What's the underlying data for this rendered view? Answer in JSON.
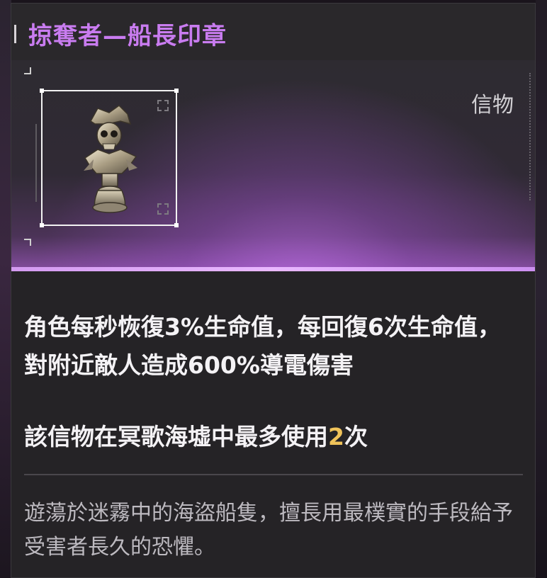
{
  "item": {
    "name": "掠奪者—船長印章",
    "category": "信物",
    "image_icon": "skull-pirate-captain-chess-piece-icon",
    "effect_text": "角色每秒恢復3%生命值，每回復6次生命值，對附近敵人造成600%導電傷害",
    "usage_prefix": "該信物在冥歌海墟中最多使用",
    "usage_count": "2",
    "usage_suffix": "次",
    "flavor_text": "遊蕩於迷霧中的海盜船隻，擅長用最樸實的手段給予受害者長久的恐懼。"
  },
  "colors": {
    "title": "#c97cf0",
    "highlight_number": "#f0c35a",
    "banner_glow": "#7e4a97"
  }
}
